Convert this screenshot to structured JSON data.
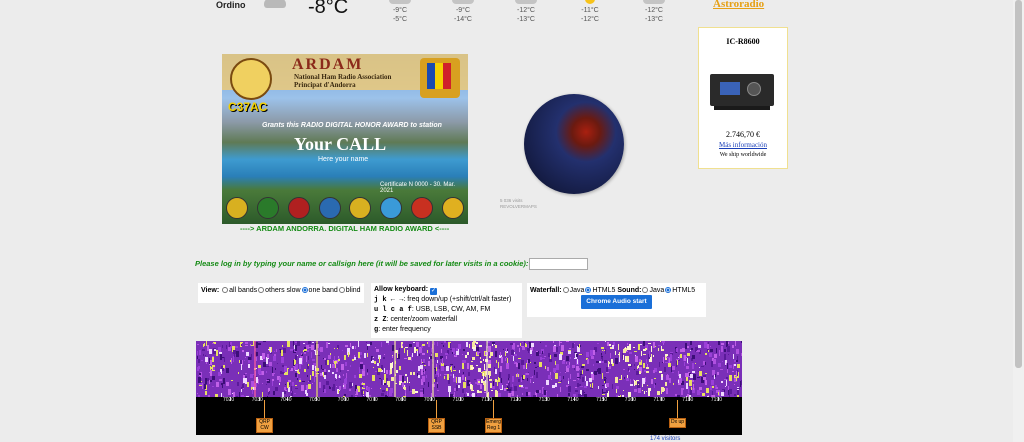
{
  "weather": {
    "city": "Ordino",
    "current_temp": "-8°C",
    "forecast": [
      {
        "icon": "cloud-icon",
        "high": "-9°C",
        "low": "-5°C"
      },
      {
        "icon": "cloud-icon",
        "high": "-9°C",
        "low": "-14°C"
      },
      {
        "icon": "cloud-icon",
        "high": "-12°C",
        "low": "-13°C"
      },
      {
        "icon": "sun-icon",
        "high": "-11°C",
        "low": "-12°C"
      },
      {
        "icon": "cloud-icon",
        "high": "-12°C",
        "low": "-13°C"
      }
    ]
  },
  "ad": {
    "brand": "Astroradio",
    "title": "IC-R8600",
    "price": "2.746,70 €",
    "link": "Más información",
    "shipping": "We ship worldwide"
  },
  "award": {
    "title": "ARDAM",
    "subtitle1": "National Ham Radio Association",
    "subtitle2": "Principat d'Andorra",
    "callsign_badge": "C37AC",
    "grant_text": "Grants this RADIO DIGITAL HONOR AWARD to station",
    "call": "Your CALL",
    "name": "Here your name",
    "certificate": "Certificate N 0000 - 30. Mar. 2021",
    "footer": "----> ARDAM ANDORRA. DIGITAL HAM RADIO AWARD <----",
    "badge_colors": [
      "#d8b020",
      "#2a7a2a",
      "#b02020",
      "#2a6ab0",
      "#d8b020",
      "#3a9ad8",
      "#c83020",
      "#e0b020"
    ]
  },
  "globe": {
    "caption_line1": "5 036 visits",
    "caption_line2": "REVOLVERMAPS"
  },
  "login": {
    "prompt": "Please log in by typing your name or callsign here (it will be saved for later visits in a cookie):",
    "value": ""
  },
  "view": {
    "label": "View:",
    "options": [
      "all bands",
      "others slow",
      "one band",
      "blind"
    ],
    "selected": "one band"
  },
  "keyboard": {
    "label": "Allow keyboard:",
    "checked": true,
    "lines": [
      {
        "keys": "j k ← →",
        "desc": ": freq down/up (+shift/ctrl/alt faster)"
      },
      {
        "keys": "u l c a f",
        "desc": ": USB, LSB, CW, AM, FM"
      },
      {
        "keys": "z Z",
        "desc": ": center/zoom waterfall"
      },
      {
        "keys": "g",
        "desc": ": enter frequency"
      }
    ]
  },
  "waterfall_controls": {
    "waterfall_label": "Waterfall:",
    "sound_label": "Sound:",
    "options": [
      "Java",
      "HTML5"
    ],
    "waterfall_selected": "HTML5",
    "sound_selected": "HTML5",
    "button": "Chrome Audio start"
  },
  "scale": {
    "labels": [
      "7020",
      "7030",
      "7040",
      "7050",
      "7060",
      "7070",
      "7080",
      "7090",
      "7100",
      "7110",
      "7120",
      "7130",
      "7140",
      "7150",
      "7160",
      "7170",
      "7180",
      "7190"
    ],
    "markers": [
      {
        "line1": "QRP",
        "line2": "CW"
      },
      {
        "line1": "QRP",
        "line2": "SSB"
      },
      {
        "line1": "Emerg",
        "line2": "Reg 1"
      },
      {
        "line1": "Dx up",
        "line2": ""
      }
    ]
  },
  "bottom": {
    "text": "174 visitors"
  }
}
